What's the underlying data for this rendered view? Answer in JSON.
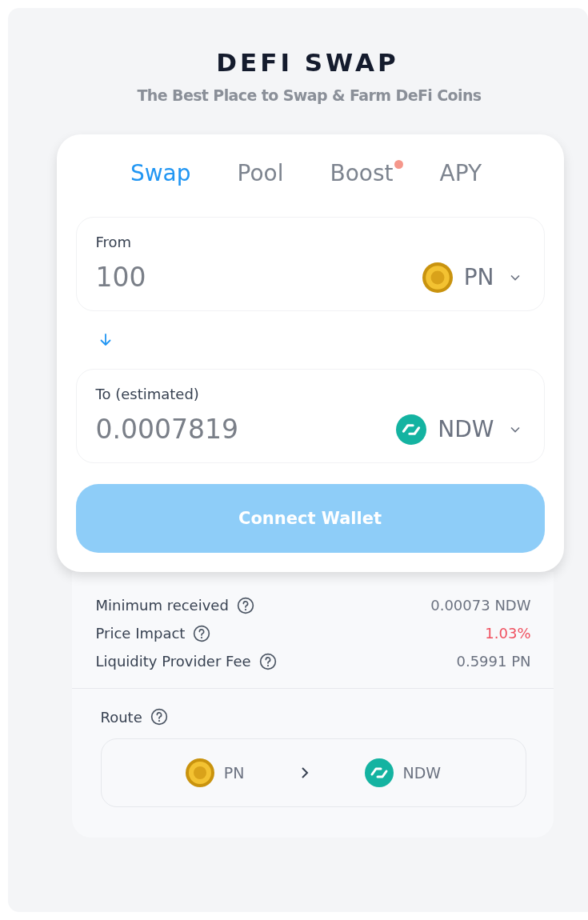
{
  "header": {
    "title": "DEFI SWAP",
    "subtitle": "The Best Place to Swap & Farm DeFi Coins"
  },
  "tabs": [
    {
      "label": "Swap",
      "selected": true,
      "dot": false
    },
    {
      "label": "Pool",
      "selected": false,
      "dot": false
    },
    {
      "label": "Boost",
      "selected": false,
      "dot": true
    },
    {
      "label": "APY",
      "selected": false,
      "dot": false
    }
  ],
  "from": {
    "label": "From",
    "value": "100",
    "token": {
      "symbol": "PN",
      "kind": "gold"
    }
  },
  "to": {
    "label": "To (estimated)",
    "value": "0.0007819",
    "token": {
      "symbol": "NDW",
      "kind": "teal"
    }
  },
  "button": {
    "label": "Connect Wallet",
    "disabled": true
  },
  "details": [
    {
      "label": "Minimum received",
      "value": "0.00073 NDW",
      "warning": false
    },
    {
      "label": "Price Impact",
      "value": "1.03%",
      "warning": true
    },
    {
      "label": "Liquidity Provider Fee",
      "value": "0.5991 PN",
      "warning": false
    }
  ],
  "route": {
    "label": "Route",
    "steps": [
      {
        "symbol": "PN",
        "kind": "gold"
      },
      {
        "symbol": "NDW",
        "kind": "teal"
      }
    ]
  }
}
